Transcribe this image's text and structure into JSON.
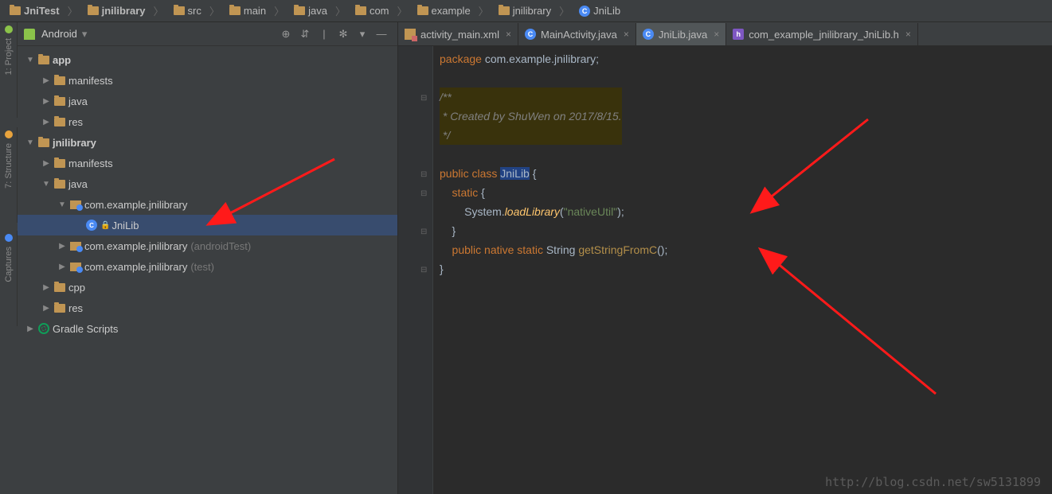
{
  "breadcrumb": [
    {
      "icon": "folder",
      "label": "JniTest",
      "bold": true
    },
    {
      "icon": "folder",
      "label": "jnilibrary",
      "bold": true
    },
    {
      "icon": "folder",
      "label": "src"
    },
    {
      "icon": "folder",
      "label": "main"
    },
    {
      "icon": "folder",
      "label": "java"
    },
    {
      "icon": "folder",
      "label": "com"
    },
    {
      "icon": "folder",
      "label": "example"
    },
    {
      "icon": "folder",
      "label": "jnilibrary"
    },
    {
      "icon": "class",
      "label": "JniLib"
    }
  ],
  "sideStrips": {
    "s1": {
      "label": "1: Project",
      "color": "#8bc34a"
    },
    "s2": {
      "label": "7: Structure",
      "color": "#e8a33d"
    },
    "s3": {
      "label": "Captures",
      "color": "#4a8af4"
    }
  },
  "projectBar": {
    "selector": "Android",
    "icons": {
      "target": "⊕",
      "collapse": "⇵",
      "sep": "|",
      "gear": "✻",
      "arrow": "▾",
      "hide": "—"
    }
  },
  "tree": [
    {
      "d": 0,
      "a": "exp",
      "ic": "folder",
      "lbl": "app",
      "bold": true
    },
    {
      "d": 1,
      "a": "col",
      "ic": "folder",
      "lbl": "manifests"
    },
    {
      "d": 1,
      "a": "col",
      "ic": "folder",
      "lbl": "java"
    },
    {
      "d": 1,
      "a": "col",
      "ic": "folder",
      "lbl": "res"
    },
    {
      "d": 0,
      "a": "exp",
      "ic": "folder",
      "lbl": "jnilibrary",
      "bold": true
    },
    {
      "d": 1,
      "a": "col",
      "ic": "folder",
      "lbl": "manifests"
    },
    {
      "d": 1,
      "a": "exp",
      "ic": "folder",
      "lbl": "java"
    },
    {
      "d": 2,
      "a": "exp",
      "ic": "pkg",
      "lbl": "com.example.jnilibrary"
    },
    {
      "d": 3,
      "a": "none",
      "ic": "jni",
      "lbl": "JniLib",
      "sel": true,
      "lock": true
    },
    {
      "d": 2,
      "a": "col",
      "ic": "pkg",
      "lbl": "com.example.jnilibrary",
      "suffix": "(androidTest)"
    },
    {
      "d": 2,
      "a": "col",
      "ic": "pkg",
      "lbl": "com.example.jnilibrary",
      "suffix": "(test)"
    },
    {
      "d": 1,
      "a": "col",
      "ic": "folder",
      "lbl": "cpp"
    },
    {
      "d": 1,
      "a": "col",
      "ic": "folder",
      "lbl": "res"
    },
    {
      "d": 0,
      "a": "col",
      "ic": "gradle",
      "lbl": "Gradle Scripts"
    }
  ],
  "tabs": [
    {
      "ic": "xml",
      "label": "activity_main.xml",
      "active": false
    },
    {
      "ic": "class",
      "label": "MainActivity.java",
      "active": false
    },
    {
      "ic": "class",
      "label": "JniLib.java",
      "active": true
    },
    {
      "ic": "h",
      "label": "com_example_jnilibrary_JniLib.h",
      "active": false
    }
  ],
  "code": {
    "l1_kw": "package",
    "l1_pkg": " com.example.jnilibrary;",
    "l3": "/**",
    "l4": " * Created by ShuWen on 2017/8/15.",
    "l5": " */",
    "l7_kw": "public class ",
    "l7_cls": "JniLib",
    "l7_end": " {",
    "l8_kw": "    static ",
    "l8_end": "{",
    "l9_a": "        System.",
    "l9_m": "loadLibrary",
    "l9_b": "(",
    "l9_s": "\"nativeUtil\"",
    "l9_c": ");",
    "l10": "    }",
    "l11_kw": "    public native static ",
    "l11_t": "String ",
    "l11_m": "getStringFromC",
    "l11_end": "();",
    "l12": "}"
  },
  "watermark": "http://blog.csdn.net/sw5131899"
}
